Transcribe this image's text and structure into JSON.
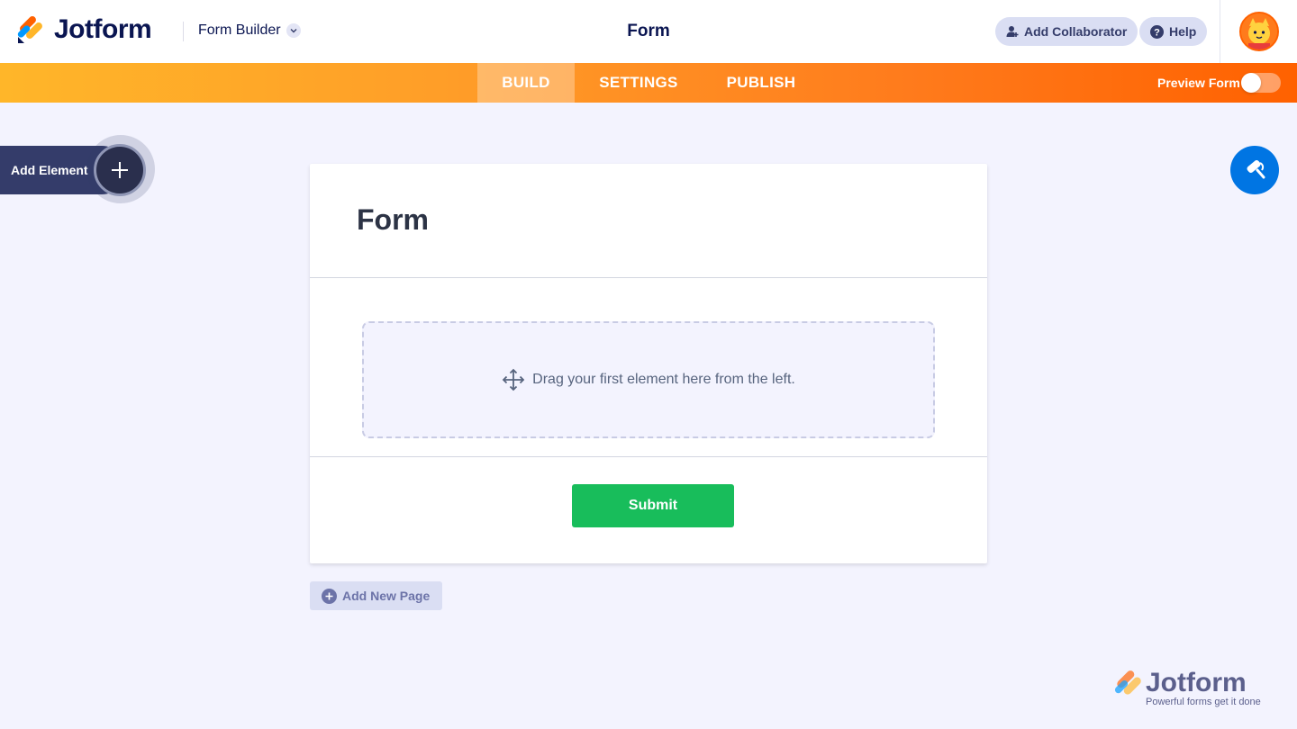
{
  "header": {
    "brand": "Jotform",
    "builder_label": "Form Builder",
    "title": "Form",
    "add_collaborator": "Add Collaborator",
    "help": "Help"
  },
  "nav": {
    "tabs": [
      {
        "label": "BUILD",
        "active": true
      },
      {
        "label": "SETTINGS",
        "active": false
      },
      {
        "label": "PUBLISH",
        "active": false
      }
    ],
    "preview_label": "Preview Form",
    "preview_on": false
  },
  "sidebar": {
    "add_element": "Add Element"
  },
  "form": {
    "title": "Form",
    "drop_hint": "Drag your first element here from the left.",
    "submit": "Submit",
    "add_page": "Add New Page"
  },
  "watermark": {
    "brand": "Jotform",
    "tagline": "Powerful forms get it done"
  },
  "colors": {
    "accent_orange": "#ff6100",
    "submit_green": "#18bd5b",
    "designer_blue": "#0075e3",
    "navy": "#0a1551"
  }
}
